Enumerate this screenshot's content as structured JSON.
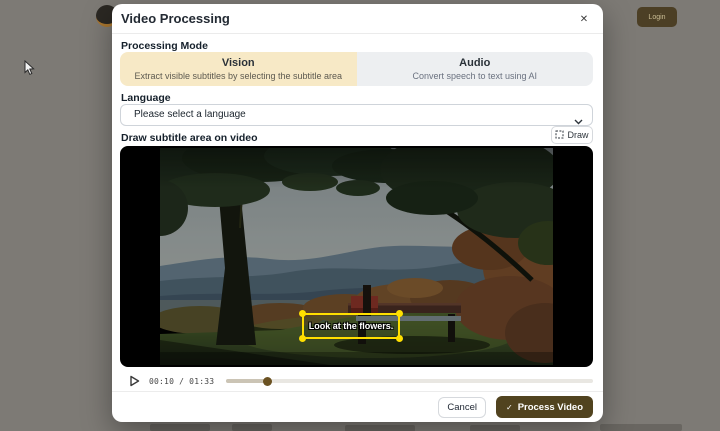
{
  "background": {
    "login_label": "Login"
  },
  "modal": {
    "title": "Video Processing",
    "sections": {
      "processing_mode": {
        "label": "Processing Mode",
        "selected": "Vision",
        "options": [
          {
            "title": "Vision",
            "description": "Extract visible subtitles by selecting the subtitle area"
          },
          {
            "title": "Audio",
            "description": "Convert speech to text using AI"
          }
        ]
      },
      "language": {
        "label": "Language",
        "selected_value": "Please select a language"
      },
      "draw": {
        "label": "Draw subtitle area on video",
        "button_label": "Draw"
      }
    },
    "player": {
      "subtitle_overlay_text": "Look at the flowers.",
      "current_time": "00:10",
      "separator": "/",
      "duration": "01:33",
      "progress_percent": 11
    },
    "footer": {
      "cancel_label": "Cancel",
      "process_label": "Process Video"
    }
  },
  "icons": {
    "close": "✕",
    "check": "✓"
  },
  "colors": {
    "overlay_backdrop": "#7d7a75",
    "vision_selected_bg": "#f7e9c6",
    "audio_bg": "#edeff1",
    "accent_brown": "#51431f",
    "selection_yellow": "#ffdf00",
    "progress_thumb": "#6b5222"
  }
}
